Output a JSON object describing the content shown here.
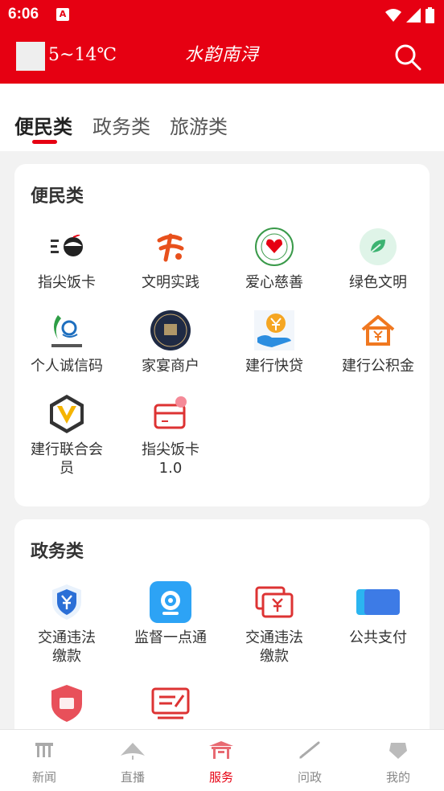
{
  "status_bar": {
    "time": "6:06",
    "app_icon": "A"
  },
  "header": {
    "temperature": "5~14℃",
    "logo_text": "水韵南浔"
  },
  "tabs": [
    {
      "label": "便民类"
    },
    {
      "label": "政务类"
    },
    {
      "label": "旅游类"
    }
  ],
  "sections": {
    "convenience": {
      "title": "便民类",
      "items": [
        {
          "label": "指尖饭卡",
          "icon": "meal-card-icon"
        },
        {
          "label": "文明实践",
          "icon": "civilization-practice-icon"
        },
        {
          "label": "爱心慈善",
          "icon": "charity-icon"
        },
        {
          "label": "绿色文明",
          "icon": "green-leaf-icon"
        },
        {
          "label": "个人诚信码",
          "icon": "credit-code-icon"
        },
        {
          "label": "家宴商户",
          "icon": "family-banquet-icon"
        },
        {
          "label": "建行快贷",
          "icon": "ccb-loan-icon"
        },
        {
          "label": "建行公积金",
          "icon": "housing-fund-icon"
        },
        {
          "label": "建行联合会员",
          "icon": "ccb-member-icon"
        },
        {
          "label": "指尖饭卡1.0",
          "icon": "meal-card-v1-icon"
        }
      ]
    },
    "government": {
      "title": "政务类",
      "items": [
        {
          "label": "交通违法缴款",
          "icon": "traffic-fine-shield-icon"
        },
        {
          "label": "监督一点通",
          "icon": "camera-supervision-icon"
        },
        {
          "label": "交通违法缴款",
          "icon": "traffic-fine-cards-icon"
        },
        {
          "label": "公共支付",
          "icon": "public-payment-icon"
        },
        {
          "label": "",
          "icon": "insurance-icon"
        },
        {
          "label": "",
          "icon": "report-form-icon"
        }
      ]
    }
  },
  "bottom_nav": [
    {
      "label": "新闻",
      "icon": "news-icon"
    },
    {
      "label": "直播",
      "icon": "live-icon"
    },
    {
      "label": "服务",
      "icon": "service-icon"
    },
    {
      "label": "问政",
      "icon": "inquiry-icon"
    },
    {
      "label": "我的",
      "icon": "profile-icon"
    }
  ],
  "colors": {
    "brand_red": "#e60012",
    "background": "#f2f2f2",
    "card": "#ffffff"
  }
}
